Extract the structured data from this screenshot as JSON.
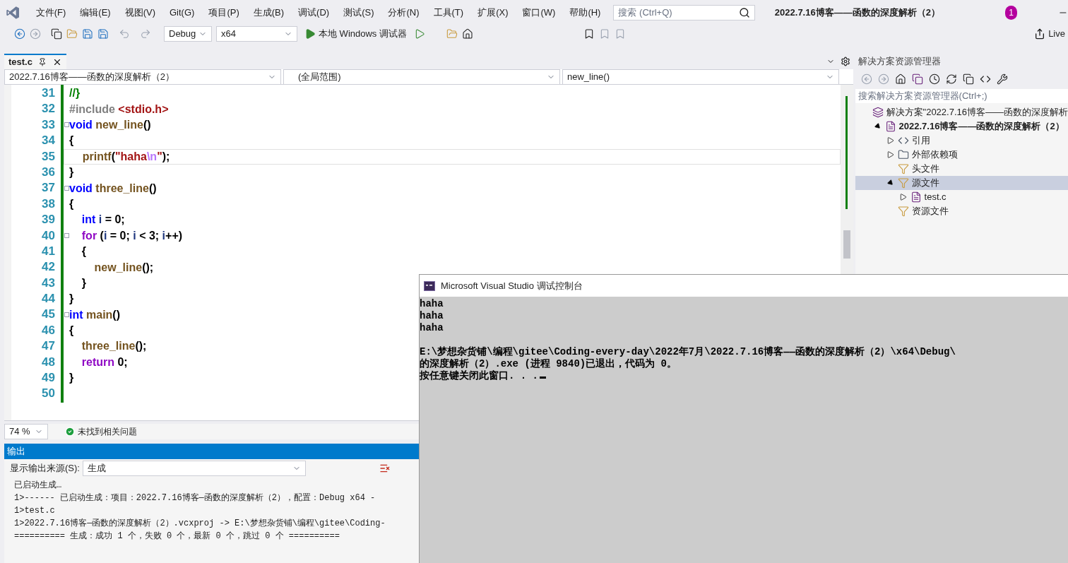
{
  "menu": [
    "文件(F)",
    "编辑(E)",
    "视图(V)",
    "Git(G)",
    "项目(P)",
    "生成(B)",
    "调试(D)",
    "测试(S)",
    "分析(N)",
    "工具(T)",
    "扩展(X)",
    "窗口(W)",
    "帮助(H)"
  ],
  "search": {
    "placeholder": "搜索 (Ctrl+Q)"
  },
  "window": {
    "title": "2022.7.16博客——函数的深度解析（2）",
    "notifications": "1"
  },
  "toolbar": {
    "configuration": "Debug",
    "platform": "x64",
    "run_label": "本地 Windows 调试器",
    "live_share": "Live"
  },
  "editor": {
    "tab": {
      "label": "test.c",
      "selected": true
    },
    "nav": [
      "2022.7.16博客——函数的深度解析（2）",
      "(全局范围)",
      "new_line()"
    ],
    "lines": [
      {
        "number": "31",
        "fold": false,
        "current": false,
        "tokens": [
          {
            "text": "//}",
            "kind": "comment"
          }
        ]
      },
      {
        "number": "32",
        "fold": false,
        "current": false,
        "tokens": [
          {
            "text": "#include ",
            "kind": "preproc"
          },
          {
            "text": "<stdio.h>",
            "kind": "string"
          }
        ]
      },
      {
        "number": "33",
        "fold": true,
        "current": false,
        "tokens": [
          {
            "text": "void ",
            "kind": "keyword"
          },
          {
            "text": "new_line",
            "kind": "function"
          },
          {
            "text": "()",
            "kind": "plain"
          }
        ]
      },
      {
        "number": "34",
        "fold": false,
        "current": false,
        "tokens": [
          {
            "text": "{",
            "kind": "plain"
          }
        ]
      },
      {
        "number": "35",
        "fold": false,
        "current": true,
        "tokens": [
          {
            "text": "    printf",
            "kind": "function"
          },
          {
            "text": "(",
            "kind": "plain"
          },
          {
            "text": "\"haha",
            "kind": "string"
          },
          {
            "text": "\\n",
            "kind": "escape"
          },
          {
            "text": "\"",
            "kind": "string"
          },
          {
            "text": ");",
            "kind": "plain"
          }
        ]
      },
      {
        "number": "36",
        "fold": false,
        "current": false,
        "tokens": [
          {
            "text": "}",
            "kind": "plain"
          }
        ]
      },
      {
        "number": "37",
        "fold": true,
        "current": false,
        "tokens": [
          {
            "text": "void ",
            "kind": "keyword"
          },
          {
            "text": "three_line",
            "kind": "function"
          },
          {
            "text": "()",
            "kind": "plain"
          }
        ]
      },
      {
        "number": "38",
        "fold": false,
        "current": false,
        "tokens": [
          {
            "text": "{",
            "kind": "plain"
          }
        ]
      },
      {
        "number": "39",
        "fold": false,
        "current": false,
        "tokens": [
          {
            "text": "    int ",
            "kind": "keyword"
          },
          {
            "text": "i",
            "kind": "variable"
          },
          {
            "text": " = 0;",
            "kind": "plain"
          }
        ]
      },
      {
        "number": "40",
        "fold": true,
        "current": false,
        "tokens": [
          {
            "text": "    for ",
            "kind": "control"
          },
          {
            "text": "(",
            "kind": "plain"
          },
          {
            "text": "i",
            "kind": "variable"
          },
          {
            "text": " = 0; ",
            "kind": "plain"
          },
          {
            "text": "i",
            "kind": "variable"
          },
          {
            "text": " < 3; ",
            "kind": "plain"
          },
          {
            "text": "i",
            "kind": "variable"
          },
          {
            "text": "++)",
            "kind": "plain"
          }
        ]
      },
      {
        "number": "41",
        "fold": false,
        "current": false,
        "tokens": [
          {
            "text": "    {",
            "kind": "plain"
          }
        ]
      },
      {
        "number": "42",
        "fold": false,
        "current": false,
        "tokens": [
          {
            "text": "        new_line",
            "kind": "function"
          },
          {
            "text": "();",
            "kind": "plain"
          }
        ]
      },
      {
        "number": "43",
        "fold": false,
        "current": false,
        "tokens": [
          {
            "text": "    }",
            "kind": "plain"
          }
        ]
      },
      {
        "number": "44",
        "fold": false,
        "current": false,
        "tokens": [
          {
            "text": "}",
            "kind": "plain"
          }
        ]
      },
      {
        "number": "45",
        "fold": true,
        "current": false,
        "tokens": [
          {
            "text": "int ",
            "kind": "keyword"
          },
          {
            "text": "main",
            "kind": "function"
          },
          {
            "text": "()",
            "kind": "plain"
          }
        ]
      },
      {
        "number": "46",
        "fold": false,
        "current": false,
        "tokens": [
          {
            "text": "{",
            "kind": "plain"
          }
        ]
      },
      {
        "number": "47",
        "fold": false,
        "current": false,
        "tokens": [
          {
            "text": "    three_line",
            "kind": "function"
          },
          {
            "text": "();",
            "kind": "plain"
          }
        ]
      },
      {
        "number": "48",
        "fold": false,
        "current": false,
        "tokens": [
          {
            "text": "    return ",
            "kind": "control"
          },
          {
            "text": "0;",
            "kind": "plain"
          }
        ]
      },
      {
        "number": "49",
        "fold": false,
        "current": false,
        "tokens": [
          {
            "text": "}",
            "kind": "plain"
          }
        ]
      },
      {
        "number": "50",
        "fold": false,
        "current": false
      }
    ],
    "zoom": "74 %",
    "issues": "未找到相关问题"
  },
  "output": {
    "title": "输出",
    "source_label": "显示输出来源(S):",
    "source": "生成",
    "lines": [
      "已启动生成…",
      "1>------ 已启动生成：项目：2022.7.16博客—函数的深度解析（2），配置：Debug x64 -",
      "1>test.c",
      "1>2022.7.16博客—函数的深度解析（2）.vcxproj -> E:\\梦想杂货铺\\编程\\gitee\\Coding-",
      "========== 生成：成功 1 个，失败 0 个，最新 0 个，跳过 0 个 =========="
    ]
  },
  "solution_explorer": {
    "title": "解决方案资源管理器",
    "search": {
      "placeholder": "搜索解决方案资源管理器(Ctrl+;)"
    },
    "tree": [
      {
        "label": "解决方案\"2022.7.16博客——函数的深度解析",
        "kind": "solution",
        "expandable": false,
        "selected": false,
        "children": [
          {
            "label": "2022.7.16博客——函数的深度解析（2）",
            "kind": "project",
            "expandable": true,
            "expanded": true,
            "selected": false,
            "children": [
              {
                "label": "引用",
                "kind": "references",
                "expandable": true,
                "expanded": false,
                "selected": false
              },
              {
                "label": "外部依赖项",
                "kind": "external",
                "expandable": true,
                "expanded": false,
                "selected": false
              },
              {
                "label": "头文件",
                "kind": "filter",
                "expandable": false,
                "selected": false
              },
              {
                "label": "源文件",
                "kind": "filter",
                "expandable": true,
                "expanded": true,
                "selected": true,
                "children": [
                  {
                    "label": "test.c",
                    "kind": "file",
                    "expandable": true,
                    "expanded": false,
                    "selected": false
                  }
                ]
              },
              {
                "label": "资源文件",
                "kind": "filter",
                "expandable": false,
                "selected": false
              }
            ]
          }
        ]
      }
    ]
  },
  "console": {
    "title": "Microsoft Visual Studio 调试控制台",
    "program_output": [
      "haha",
      "haha",
      "haha"
    ],
    "messages": [
      "E:\\梦想杂货铺\\编程\\gitee\\Coding-every-day\\2022年7月\\2022.7.16博客——函数的深度解析（2）\\x64\\Debug\\",
      "的深度解析（2）.exe (进程 9840)已退出，代码为 0。",
      "按任意键关闭此窗口. . ."
    ]
  }
}
